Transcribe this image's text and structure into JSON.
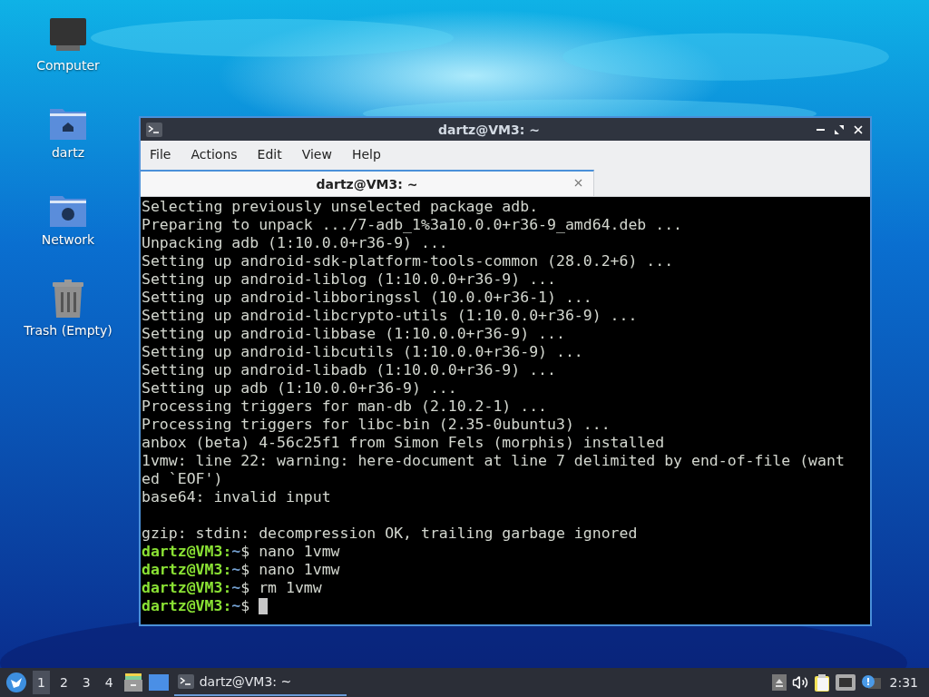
{
  "desktop_icons": [
    {
      "label": "Computer",
      "kind": "computer"
    },
    {
      "label": "dartz",
      "kind": "home"
    },
    {
      "label": "Network",
      "kind": "network"
    },
    {
      "label": "Trash (Empty)",
      "kind": "trash"
    }
  ],
  "window": {
    "title": "dartz@VM3: ~",
    "menu": [
      "File",
      "Actions",
      "Edit",
      "View",
      "Help"
    ],
    "tabs": [
      {
        "label": "dartz@VM3: ~",
        "selected": true
      }
    ],
    "lines": [
      {
        "kind": "output",
        "text": "Selecting previously unselected package adb."
      },
      {
        "kind": "output",
        "text": "Preparing to unpack .../7-adb_1%3a10.0.0+r36-9_amd64.deb ..."
      },
      {
        "kind": "output",
        "text": "Unpacking adb (1:10.0.0+r36-9) ..."
      },
      {
        "kind": "output",
        "text": "Setting up android-sdk-platform-tools-common (28.0.2+6) ..."
      },
      {
        "kind": "output",
        "text": "Setting up android-liblog (1:10.0.0+r36-9) ..."
      },
      {
        "kind": "output",
        "text": "Setting up android-libboringssl (10.0.0+r36-1) ..."
      },
      {
        "kind": "output",
        "text": "Setting up android-libcrypto-utils (1:10.0.0+r36-9) ..."
      },
      {
        "kind": "output",
        "text": "Setting up android-libbase (1:10.0.0+r36-9) ..."
      },
      {
        "kind": "output",
        "text": "Setting up android-libcutils (1:10.0.0+r36-9) ..."
      },
      {
        "kind": "output",
        "text": "Setting up android-libadb (1:10.0.0+r36-9) ..."
      },
      {
        "kind": "output",
        "text": "Setting up adb (1:10.0.0+r36-9) ..."
      },
      {
        "kind": "output",
        "text": "Processing triggers for man-db (2.10.2-1) ..."
      },
      {
        "kind": "output",
        "text": "Processing triggers for libc-bin (2.35-0ubuntu3) ..."
      },
      {
        "kind": "output",
        "text": "anbox (beta) 4-56c25f1 from Simon Fels (morphis) installed"
      },
      {
        "kind": "output",
        "text": "1vmw: line 22: warning: here-document at line 7 delimited by end-of-file (want"
      },
      {
        "kind": "output",
        "text": "ed `EOF')"
      },
      {
        "kind": "output",
        "text": "base64: invalid input"
      },
      {
        "kind": "blank"
      },
      {
        "kind": "output",
        "text": "gzip: stdin: decompression OK, trailing garbage ignored"
      },
      {
        "kind": "prompt",
        "user": "dartz@VM3:",
        "path": "~",
        "command": "$ nano 1vmw",
        "cursor": false
      },
      {
        "kind": "prompt",
        "user": "dartz@VM3:",
        "path": "~",
        "command": "$ nano 1vmw",
        "cursor": false
      },
      {
        "kind": "prompt",
        "user": "dartz@VM3:",
        "path": "~",
        "command": "$ rm 1vmw",
        "cursor": false
      },
      {
        "kind": "prompt",
        "user": "dartz@VM3:",
        "path": "~",
        "command": "$",
        "cursor": true
      }
    ]
  },
  "taskbar": {
    "workspaces": [
      {
        "label": "1",
        "selected": true
      },
      {
        "label": "2",
        "selected": false
      },
      {
        "label": "3",
        "selected": false
      },
      {
        "label": "4",
        "selected": false
      }
    ],
    "tasks": [
      {
        "label": "dartz@VM3: ~",
        "selected": true
      }
    ],
    "clock": "2:31"
  }
}
